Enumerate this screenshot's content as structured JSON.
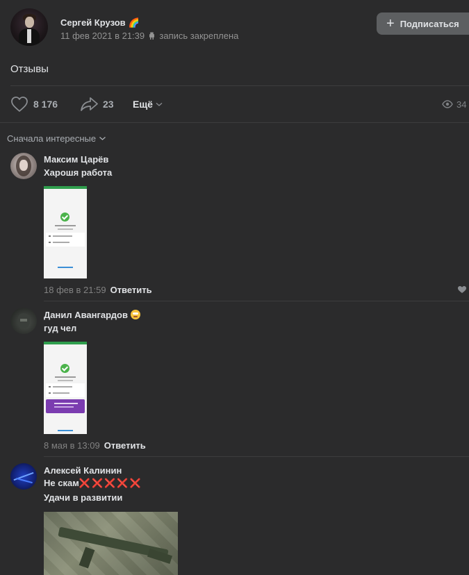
{
  "post": {
    "author": "Сергей Крузов",
    "author_emoji": "🌈",
    "date": "11 фев 2021 в 21:39",
    "pinned_label": "запись закреплена",
    "subscribe_label": "Подписаться",
    "text": "Отзывы",
    "likes": "8 176",
    "shares": "23",
    "more_label": "Ещё",
    "views": "34"
  },
  "comments_sort": "Сначала интересные",
  "comments": [
    {
      "author": "Максим Царёв",
      "text": "Харошя работа",
      "date": "18 фев в 21:59",
      "reply_label": "Ответить"
    },
    {
      "author": "Данил Авангардов",
      "text": "гуд чел",
      "date": "8 мая в 13:09",
      "reply_label": "Ответить"
    },
    {
      "author": "Алексей Калинин",
      "text_line1": "Не скам",
      "text_line1_emoji": "❌❌❌❌❌",
      "text_line2": "Удачи в развитии"
    }
  ],
  "icons": {
    "heart": "heart-icon",
    "share": "share-arrow-icon",
    "eye": "eye-icon",
    "pin": "android-pin-icon",
    "chevron": "chevron-down-icon"
  },
  "colors": {
    "background": "#2b2b2c",
    "button": "#5d5f61",
    "text": "#e1e3e6",
    "muted": "#939393"
  }
}
